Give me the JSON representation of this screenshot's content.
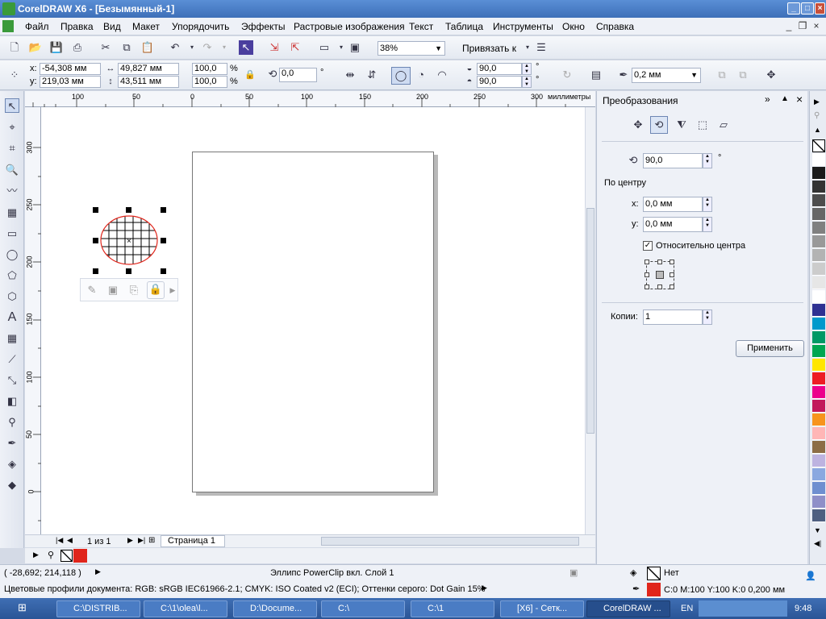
{
  "title": "CorelDRAW X6 - [Безымянный-1]",
  "menu": [
    "Файл",
    "Правка",
    "Вид",
    "Макет",
    "Упорядочить",
    "Эффекты",
    "Растровые изображения",
    "Текст",
    "Таблица",
    "Инструменты",
    "Окно",
    "Справка"
  ],
  "toolbar": {
    "zoom": "38%",
    "snap": "Привязать к"
  },
  "props": {
    "x": "-54,308 мм",
    "y": "219,03 мм",
    "width": "49,827 мм",
    "height": "43,511 мм",
    "scale_w": "100,0",
    "scale_h": "100,0",
    "pct": "%",
    "angle": "0,0",
    "deg": "°",
    "arc_start": "90,0",
    "arc_end": "90,0",
    "outline": "0,2 мм",
    "x_label": "x:",
    "y_label": "y:"
  },
  "ruler": {
    "h_ticks": [
      "100",
      "50",
      "0",
      "50",
      "100",
      "150",
      "200",
      "250",
      "300"
    ],
    "unit": "миллиметры",
    "v_ticks": [
      "300",
      "250",
      "200",
      "150",
      "100",
      "50",
      "0"
    ]
  },
  "pages": {
    "count": "1 из 1",
    "tab": "Страница 1"
  },
  "docker": {
    "title": "Преобразования",
    "angle": "90,0",
    "deg": "°",
    "center_label": "По центру",
    "x_label": "x:",
    "x": "0,0 мм",
    "y_label": "y:",
    "y": "0,0 мм",
    "relative": "Относительно центра",
    "copies_label": "Копии:",
    "copies": "1",
    "apply": "Применить"
  },
  "status": {
    "coords": "( -28,692; 214,118 )",
    "object": "Эллипс PowerClip вкл. Слой 1",
    "profiles": "Цветовые профили документа: RGB: sRGB IEC61966-2.1; CMYK: ISO Coated v2 (ECI); Оттенки серого: Dot Gain 15%",
    "fill": "Нет",
    "outline": "C:0 M:100 Y:100 K:0  0,200 мм"
  },
  "palette": [
    "#ffffff",
    "#1a1a1a",
    "#333333",
    "#4d4d4d",
    "#666666",
    "#808080",
    "#999999",
    "#b3b3b3",
    "#cccccc",
    "#e6e6e6",
    "#ffffff",
    "#2e3192",
    "#0099cc",
    "#009966",
    "#00a651",
    "#ffe600",
    "#ed1c24",
    "#ec008c",
    "#c2185b",
    "#f7941d",
    "#ffb6b6",
    "#8c6d46",
    "#bdb3e0",
    "#8aa8e0",
    "#6f8fd0",
    "#8f8fc8",
    "#4e5f80"
  ],
  "colors": {
    "accent_red": "#e0251b",
    "title_blue": "#3d6fb8"
  },
  "taskbar": {
    "items": [
      "C:\\DISTRIB...",
      "C:\\1\\olea\\l...",
      "D:\\Docume...",
      "C:\\",
      "C:\\1",
      "[X6] - Сетк...",
      "CorelDRAW ..."
    ],
    "lang": "EN",
    "clock": "9:48"
  }
}
